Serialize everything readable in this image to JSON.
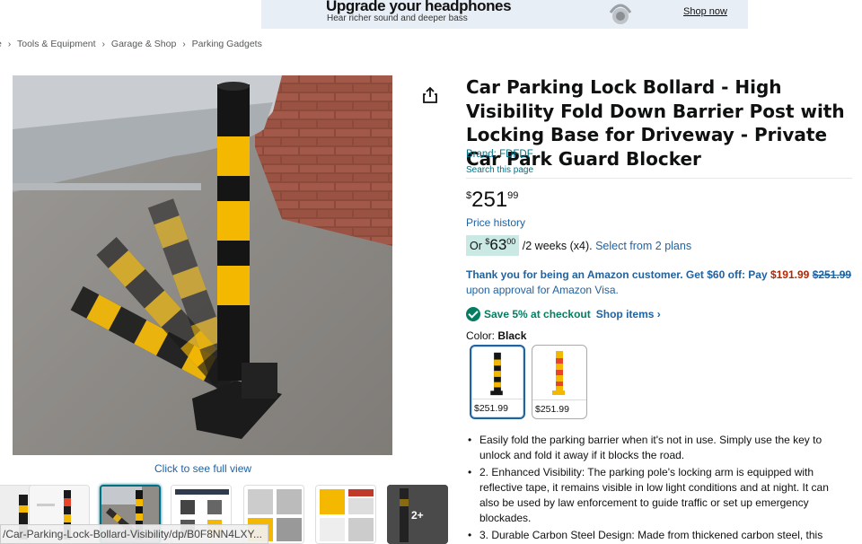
{
  "ad": {
    "title": "Upgrade your headphones",
    "subtitle": "Hear richer sound and deeper bass",
    "cta": "Shop now"
  },
  "breadcrumb": [
    "e",
    "Tools & Equipment",
    "Garage & Shop",
    "Parking Gadgets"
  ],
  "breadcrumb_sep": "›",
  "gallery": {
    "click_full": "Click to see full view",
    "more_label": "2+"
  },
  "status_url": "/Car-Parking-Lock-Bollard-Visibility/dp/B0F8NN4LXY...",
  "product": {
    "title": "Car Parking Lock Bollard - High Visibility Fold Down Barrier Post with Locking Base for Driveway - Private Car Park Guard Blocker",
    "brand": "Brand: FDFDF",
    "search_page": "Search this page"
  },
  "price": {
    "symbol": "$",
    "whole": "251",
    "fraction": "99",
    "history": "Price history"
  },
  "installment": {
    "or": "Or ",
    "symbol": "$",
    "whole": "63",
    "fraction": "00",
    "terms": " /2 weeks (x4).",
    "link": "Select from 2 plans"
  },
  "offer": {
    "lead": "Thank you for being an Amazon customer. Get $60 off: Pay ",
    "new_price": "$191.99",
    "old_price": "$251.99",
    "tail": "upon approval for Amazon Visa."
  },
  "savings": {
    "text": "Save 5% at checkout",
    "link": "Shop items ›"
  },
  "color": {
    "label": "Color: ",
    "value": "Black",
    "options": [
      {
        "price": "$251.99"
      },
      {
        "price": "$251.99"
      }
    ]
  },
  "bullets": [
    "Easily fold the parking barrier when it's not in use. Simply use the key to unlock and fold it away if it blocks the road.",
    "2. Enhanced Visibility: The parking pole's locking arm is equipped with reflective tape, it remains visible in low light conditions and at night. It can also be used by law enforcement to guide traffic or set up emergency blockades.",
    "3. Durable Carbon Steel Design: Made from thickened carbon steel, this"
  ],
  "colors": {
    "link": "#2162a1",
    "teal": "#007185",
    "green": "#067d62",
    "red": "#b12704",
    "pill_bg": "#cbe9e4",
    "bollard_yellow": "#f5b800"
  }
}
